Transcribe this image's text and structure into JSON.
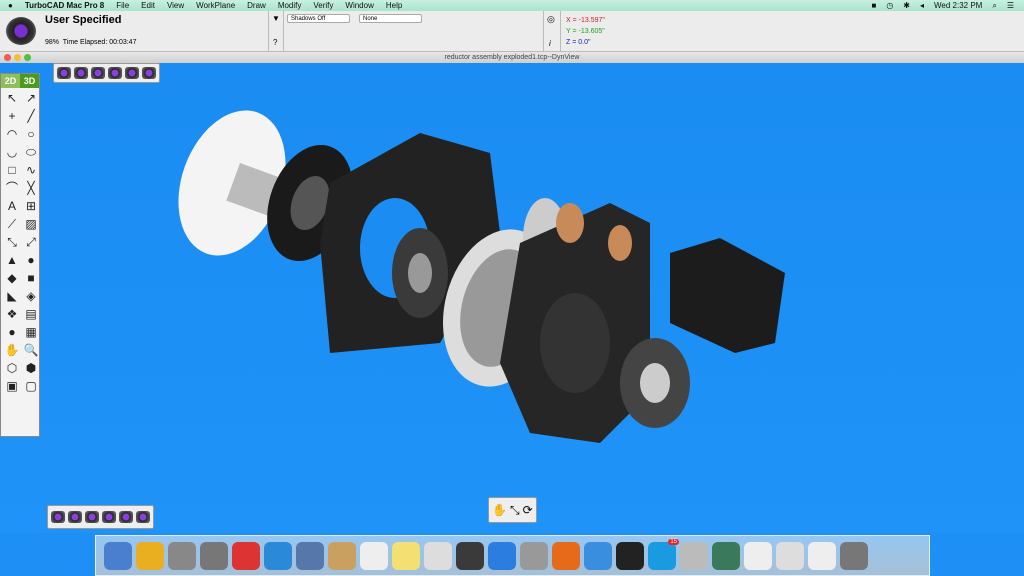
{
  "menubar": {
    "app": "TurboCAD Mac Pro 8",
    "items": [
      "File",
      "Edit",
      "View",
      "WorkPlane",
      "Draw",
      "Modify",
      "Verify",
      "Window",
      "Help"
    ],
    "clock": "Wed 2:32 PM"
  },
  "render": {
    "title": "User Specified",
    "progress": "98%",
    "elapsed": "Time Elapsed: 00:03:47",
    "progress_value": 98
  },
  "selects": {
    "shadows": "Shadows Off",
    "mode": "None"
  },
  "coords": {
    "x": "X = -13.597\"",
    "y": "Y = -13.605\"",
    "z": "Z = 0.0\""
  },
  "window": {
    "title": "reductor assembly exploded1.tcp--DynView"
  },
  "tools": {
    "toggle_2d": "2D",
    "toggle_3d": "3D",
    "icons": [
      "↖",
      "↗",
      "+",
      "╱",
      "◠",
      "○",
      "◡",
      "⬭",
      "□",
      "∿",
      "⌒",
      "╳",
      "A",
      "⊞",
      "⟋",
      "▨",
      "⤡",
      "⤢",
      "▲",
      "●",
      "◆",
      "■",
      "◣",
      "◈",
      "❖",
      "▤",
      "●",
      "▦",
      "✋",
      "🔍",
      "⬡",
      "⬢",
      "▣",
      "▢"
    ]
  },
  "dock": {
    "colors": [
      "#4a7fd0",
      "#e8b020",
      "#888",
      "#777",
      "#d33",
      "#2a8ad8",
      "#5577aa",
      "#c9a060",
      "#eee",
      "#f4e070",
      "#ddd",
      "#3a3a3a",
      "#2b7de0",
      "#999",
      "#e66a1a",
      "#3a8ee0",
      "#222",
      "#1a9ae0",
      "#bbb",
      "#3a7a5a",
      "#eee",
      "#ddd",
      "#eee",
      "#777"
    ],
    "badge": "15"
  },
  "colors": {
    "viewport": "#1e90f5",
    "x": "#d02020",
    "y": "#20a020",
    "z": "#2020c0"
  }
}
